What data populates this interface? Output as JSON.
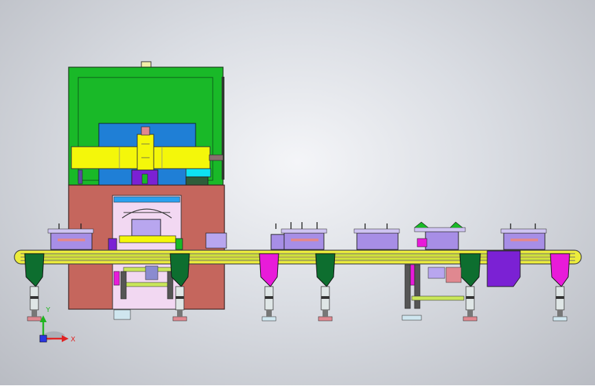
{
  "viewport": {
    "triad": {
      "x_label": "X",
      "y_label": "Y"
    }
  },
  "colors": {
    "frame_green": "#19b928",
    "dark_green": "#0d6e2f",
    "base_red": "#c5665d",
    "yellow": "#f4f70a",
    "blue": "#1f7fd6",
    "lavender": "#a78ee6",
    "magenta": "#e81bd9",
    "purple": "#7b21d4",
    "cyan": "#0ee2f2",
    "rail_yellow": "#ecec3c"
  }
}
